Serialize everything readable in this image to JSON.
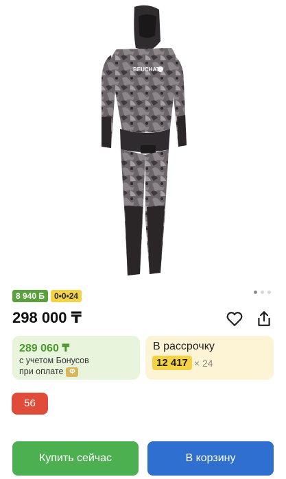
{
  "product": {
    "image_alt": "BEUCHAT",
    "bonus_badge": "8 940 Б",
    "installment_badge": "0•0•24",
    "price": "298 000 ₸",
    "bonus_price": "289 060 ₸",
    "bonus_note_line1": "с учетом Бонусов",
    "bonus_note_line2": "при оплате",
    "installment_title": "В рассрочку",
    "installment_amount": "12 417",
    "installment_months": "× 24",
    "size": "56"
  },
  "gallery": {
    "slides_total": 3,
    "active_slide": 1
  },
  "actions": {
    "buy_now_label": "Купить сейчас",
    "cart_label": "В корзину"
  },
  "icons": {
    "favorite": "heart-icon",
    "share": "share-icon",
    "pay": "pay-icon"
  },
  "colors": {
    "green": "#4caf50",
    "blue": "#2f6fd0",
    "red": "#e04b3a",
    "yellow": "#f4d247"
  }
}
